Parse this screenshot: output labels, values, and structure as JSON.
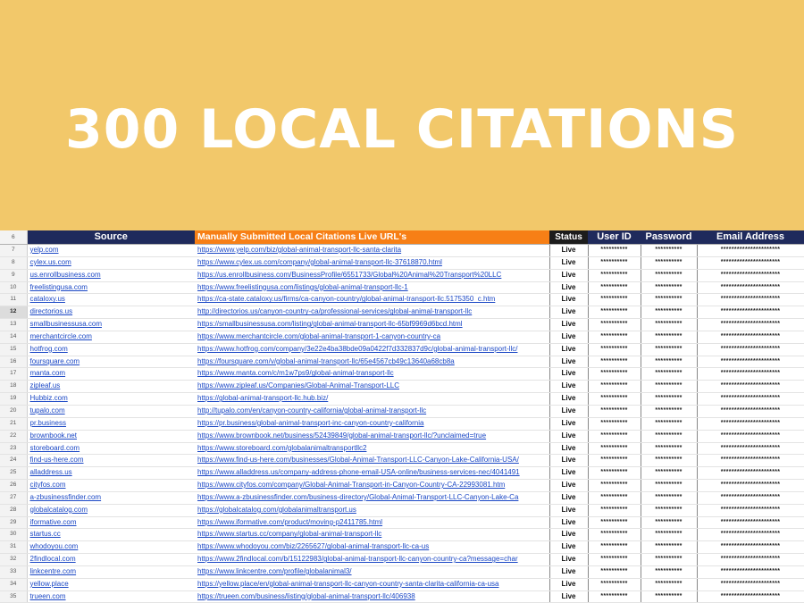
{
  "banner": {
    "title": "300 LOCAL CITATIONS"
  },
  "sheet": {
    "header": {
      "row_number": "6",
      "source": "Source",
      "url": "Manually Submitted Local Citations Live URL's",
      "status": "Status",
      "user_id": "User ID",
      "password": "Password",
      "email": "Email Address"
    },
    "masks": {
      "user_id": "**********",
      "password": "**********",
      "email": "**********************"
    },
    "selected_row": "12",
    "rows": [
      {
        "num": "7",
        "source": "yelp.com",
        "url": "https://www.yelp.com/biz/global-animal-transport-llc-santa-clarita",
        "status": "Live"
      },
      {
        "num": "8",
        "source": "cylex.us.com",
        "url": "https://www.cylex.us.com/company/global-animal-transport-llc-37618870.html",
        "status": "Live"
      },
      {
        "num": "9",
        "source": "us.enrollbusiness.com",
        "url": "https://us.enrollbusiness.com/BusinessProfile/6551733/Global%20Animal%20Transport%20LLC",
        "status": "Live"
      },
      {
        "num": "10",
        "source": "freelistingusa.com",
        "url": "https://www.freelistingusa.com/listings/global-animal-transport-llc-1",
        "status": "Live"
      },
      {
        "num": "11",
        "source": "cataloxy.us",
        "url": "https://ca-state.cataloxy.us/firms/ca-canyon-country/global-animal-transport-llc.5175350_c.htm",
        "status": "Live"
      },
      {
        "num": "12",
        "source": "directorios.us",
        "url": "http://directorios.us/canyon-country-ca/professional-services/global-animal-transport-llc",
        "status": "Live"
      },
      {
        "num": "13",
        "source": "smallbusinessusa.com",
        "url": "https://smallbusinessusa.com/listing/global-animal-transport-llc-65bf9969d6bcd.html",
        "status": "Live"
      },
      {
        "num": "14",
        "source": "merchantcircle.com",
        "url": "https://www.merchantcircle.com/global-animal-transport-1-canyon-country-ca",
        "status": "Live"
      },
      {
        "num": "15",
        "source": "hotfrog.com",
        "url": "https://www.hotfrog.com/company/3e22e4ba38bde09a0422f7d332837d9c/global-animal-transport-llc/",
        "status": "Live"
      },
      {
        "num": "16",
        "source": "foursquare.com",
        "url": "https://foursquare.com/v/global-animal-transport-llc/65e4567cb49c13640a68cb8a",
        "status": "Live"
      },
      {
        "num": "17",
        "source": "manta.com",
        "url": "https://www.manta.com/c/m1w7ps9/global-animal-transport-llc",
        "status": "Live"
      },
      {
        "num": "18",
        "source": "zipleaf.us",
        "url": "https://www.zipleaf.us/Companies/Global-Animal-Transport-LLC",
        "status": "Live"
      },
      {
        "num": "19",
        "source": "Hubbiz.com",
        "url": "https://global-animal-transport-llc.hub.biz/",
        "status": "Live"
      },
      {
        "num": "20",
        "source": "tupalo.com",
        "url": "http://tupalo.com/en/canyon-country-california/global-animal-transport-llc",
        "status": "Live"
      },
      {
        "num": "21",
        "source": "pr.business",
        "url": "https://pr.business/global-animal-transport-inc-canyon-country-california",
        "status": "Live"
      },
      {
        "num": "22",
        "source": "brownbook.net",
        "url": "https://www.brownbook.net/business/52439849/global-animal-transport-llc/?unclaimed=true",
        "status": "Live"
      },
      {
        "num": "23",
        "source": "storeboard.com",
        "url": "https://www.storeboard.com/globalanimaltransportllc2",
        "status": "Live"
      },
      {
        "num": "24",
        "source": "find-us-here.com",
        "url": "https://www.find-us-here.com/businesses/Global-Animal-Transport-LLC-Canyon-Lake-California-USA/",
        "status": "Live"
      },
      {
        "num": "25",
        "source": "alladdress.us",
        "url": "https://www.alladdress.us/company-address-phone-email-USA-online/business-services-nec/4041491",
        "status": "Live"
      },
      {
        "num": "26",
        "source": "cityfos.com",
        "url": "https://www.cityfos.com/company/Global-Animal-Transport-in-Canyon-Country-CA-22993081.htm",
        "status": "Live"
      },
      {
        "num": "27",
        "source": "a-zbusinessfinder.com",
        "url": "https://www.a-zbusinessfinder.com/business-directory/Global-Animal-Transport-LLC-Canyon-Lake-Ca",
        "status": "Live"
      },
      {
        "num": "28",
        "source": "globalcatalog.com",
        "url": "https://globalcatalog.com/globalanimaltransport.us",
        "status": "Live"
      },
      {
        "num": "29",
        "source": "iformative.com",
        "url": "https://www.iformative.com/product/moving-p2411785.html",
        "status": "Live"
      },
      {
        "num": "30",
        "source": "startus.cc",
        "url": "https://www.startus.cc/company/global-animal-transport-llc",
        "status": "Live"
      },
      {
        "num": "31",
        "source": "whodoyou.com",
        "url": "https://www.whodoyou.com/biz/2265627/global-animal-transport-llc-ca-us",
        "status": "Live"
      },
      {
        "num": "32",
        "source": "2findlocal.com",
        "url": "https://www.2findlocal.com/b/15122983/global-animal-transport-llc-canyon-country-ca?message=char",
        "status": "Live"
      },
      {
        "num": "33",
        "source": "linkcentre.com",
        "url": "https://www.linkcentre.com/profile/globalanimal3/",
        "status": "Live"
      },
      {
        "num": "34",
        "source": "yellow.place",
        "url": "https://yellow.place/en/global-animal-transport-llc-canyon-country-santa-clarita-california-ca-usa",
        "status": "Live"
      },
      {
        "num": "35",
        "source": "trueen.com",
        "url": "https://trueen.com/business/listing/global-animal-transport-llc/406938",
        "status": "Live"
      }
    ]
  }
}
